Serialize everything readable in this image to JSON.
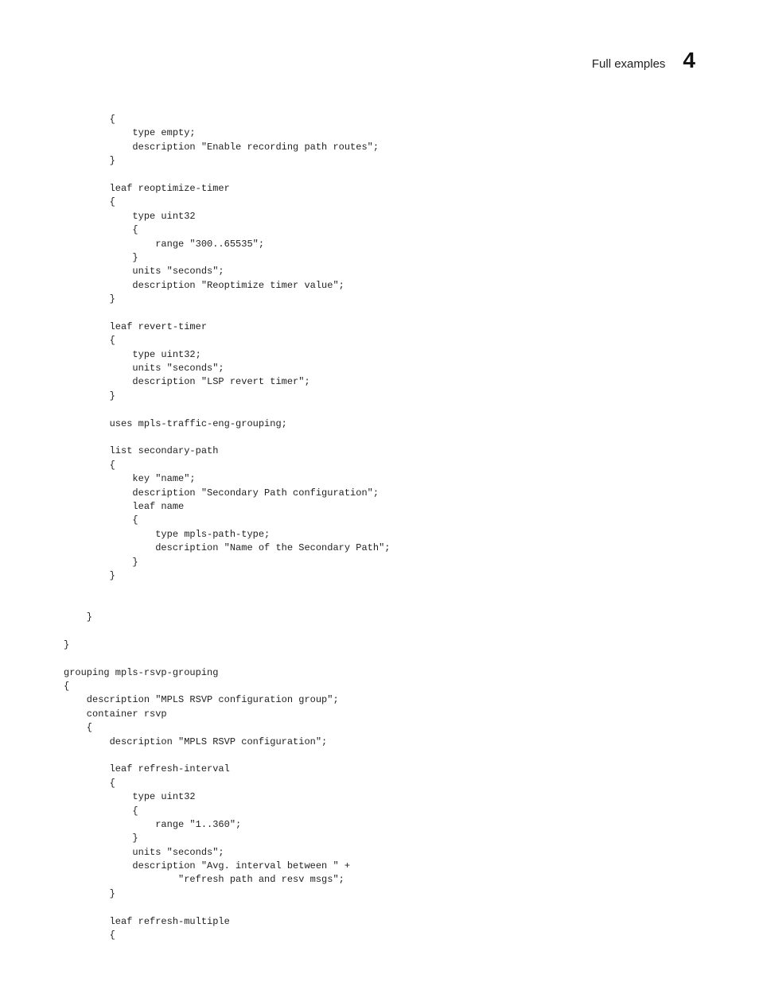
{
  "header": {
    "title": "Full examples",
    "chapter_number": "4"
  },
  "code": "        {\n            type empty;\n            description \"Enable recording path routes\";\n        }\n\n        leaf reoptimize-timer\n        {\n            type uint32\n            {\n                range \"300..65535\";\n            }\n            units \"seconds\";\n            description \"Reoptimize timer value\";\n        }\n\n        leaf revert-timer\n        {\n            type uint32;\n            units \"seconds\";\n            description \"LSP revert timer\";\n        }\n\n        uses mpls-traffic-eng-grouping;\n\n        list secondary-path\n        {\n            key \"name\";\n            description \"Secondary Path configuration\";\n            leaf name\n            {\n                type mpls-path-type;\n                description \"Name of the Secondary Path\";\n            }\n        }\n\n\n    }\n\n}\n\ngrouping mpls-rsvp-grouping\n{\n    description \"MPLS RSVP configuration group\";\n    container rsvp\n    {\n        description \"MPLS RSVP configuration\";\n\n        leaf refresh-interval\n        {\n            type uint32\n            {\n                range \"1..360\";\n            }\n            units \"seconds\";\n            description \"Avg. interval between \" +\n                    \"refresh path and resv msgs\";\n        }\n\n        leaf refresh-multiple\n        {"
}
